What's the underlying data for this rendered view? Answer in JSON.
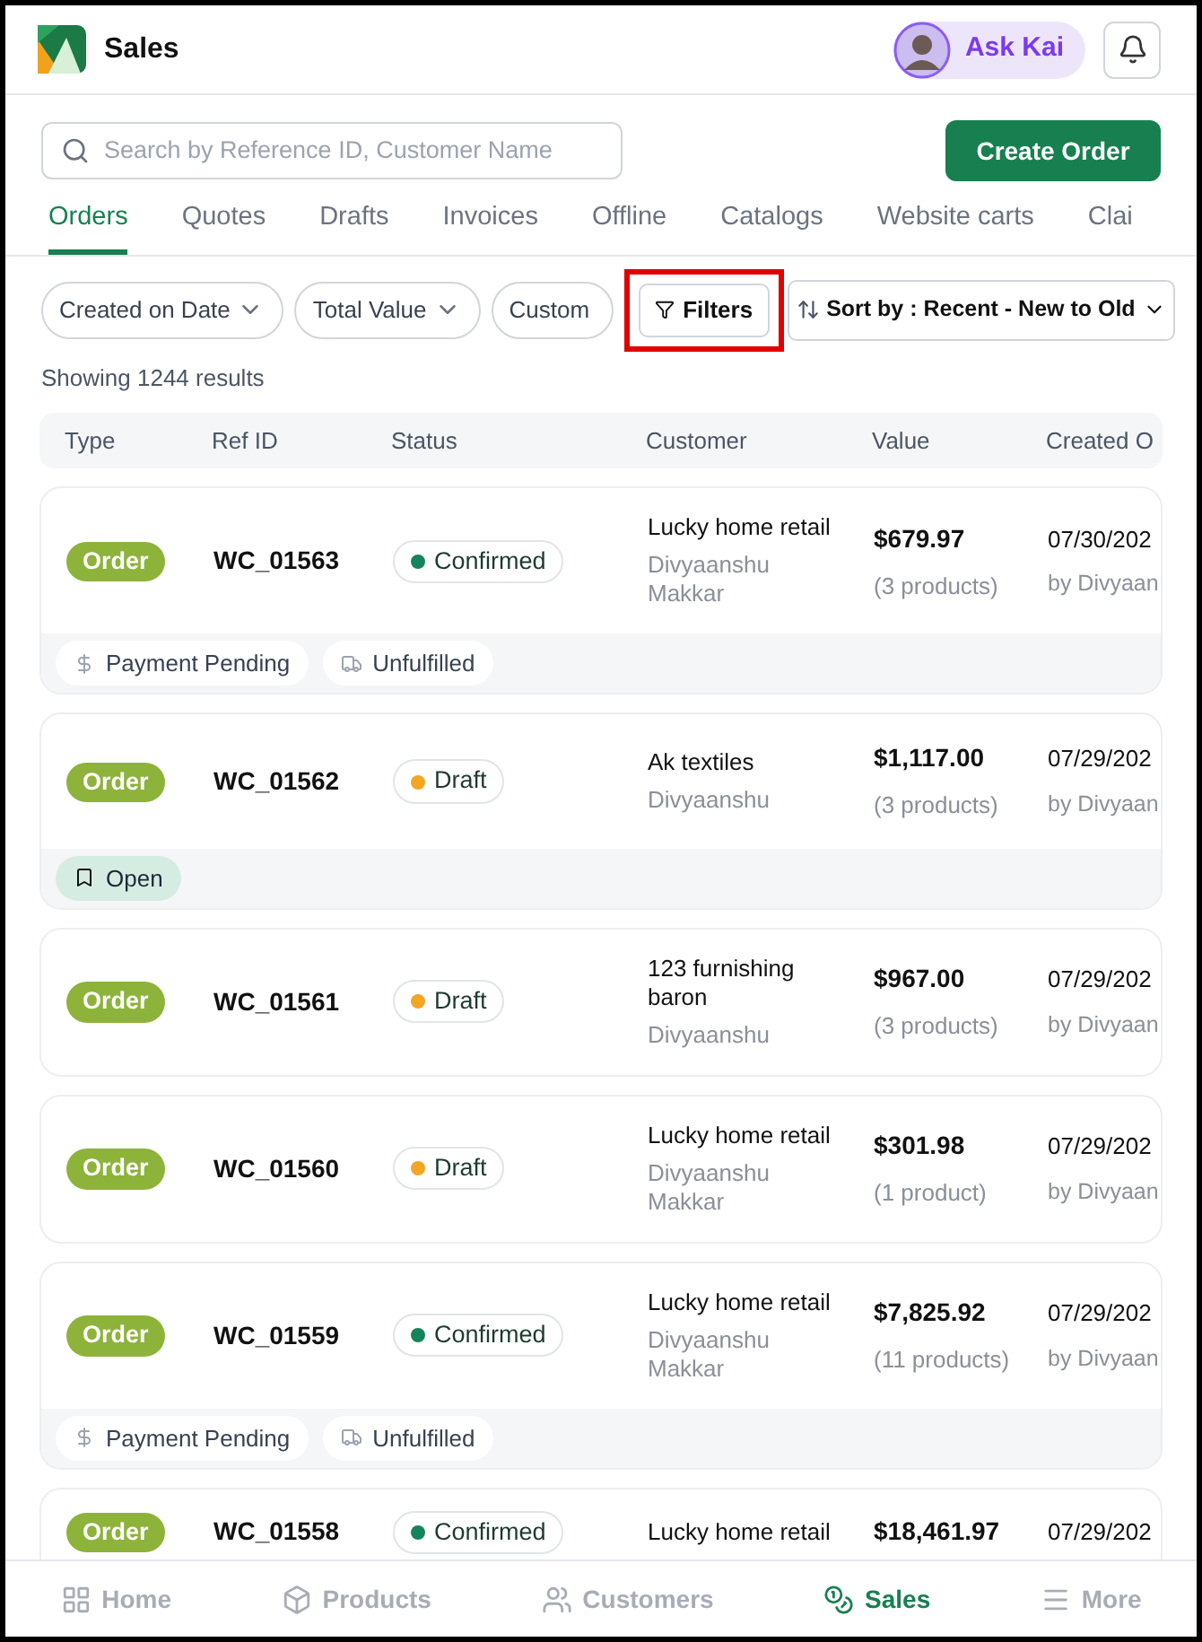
{
  "header": {
    "title": "Sales",
    "assistant": "Ask Kai"
  },
  "search": {
    "placeholder": "Search by Reference ID, Customer Name"
  },
  "create_button": "Create Order",
  "tabs": [
    {
      "label": "Orders",
      "selected": true
    },
    {
      "label": "Quotes",
      "selected": false
    },
    {
      "label": "Drafts",
      "selected": false
    },
    {
      "label": "Invoices",
      "selected": false
    },
    {
      "label": "Offline",
      "selected": false
    },
    {
      "label": "Catalogs",
      "selected": false
    },
    {
      "label": "Website carts",
      "selected": false
    },
    {
      "label": "Clai",
      "selected": false
    }
  ],
  "filters": {
    "chips": [
      "Created on Date",
      "Total Value",
      "Custom"
    ],
    "filters_button": {
      "label": "Filters",
      "highlighted": true
    },
    "sort": "Sort by : Recent - New to Old"
  },
  "result_count": "Showing 1244 results",
  "table": {
    "columns": [
      "Type",
      "Ref ID",
      "Status",
      "Customer",
      "Value",
      "Created O"
    ],
    "rows": [
      {
        "type": "Order",
        "ref_id": "WC_01563",
        "status": {
          "label": "Confirmed",
          "color": "#15845a"
        },
        "customer": "Lucky home retail",
        "contact": "Divyaanshu Makkar",
        "value": "$679.97",
        "products": "(3 products)",
        "date": "07/30/202",
        "by": "by Divyaan",
        "tags": [
          {
            "kind": "payment",
            "label": "Payment Pending"
          },
          {
            "kind": "fulfillment",
            "label": "Unfulfilled"
          }
        ]
      },
      {
        "type": "Order",
        "ref_id": "WC_01562",
        "status": {
          "label": "Draft",
          "color": "#f2a623"
        },
        "customer": "Ak textiles",
        "contact": "Divyaanshu",
        "value": "$1,117.00",
        "products": "(3 products)",
        "date": "07/29/202",
        "by": "by Divyaan",
        "tags": [
          {
            "kind": "open",
            "label": "Open"
          }
        ]
      },
      {
        "type": "Order",
        "ref_id": "WC_01561",
        "status": {
          "label": "Draft",
          "color": "#f2a623"
        },
        "customer": "123 furnishing baron",
        "contact": "Divyaanshu",
        "value": "$967.00",
        "products": "(3 products)",
        "date": "07/29/202",
        "by": "by Divyaan"
      },
      {
        "type": "Order",
        "ref_id": "WC_01560",
        "status": {
          "label": "Draft",
          "color": "#f2a623"
        },
        "customer": "Lucky home retail",
        "contact": "Divyaanshu Makkar",
        "value": "$301.98",
        "products": "(1 product)",
        "date": "07/29/202",
        "by": "by Divyaan"
      },
      {
        "type": "Order",
        "ref_id": "WC_01559",
        "status": {
          "label": "Confirmed",
          "color": "#15845a"
        },
        "customer": "Lucky home retail",
        "contact": "Divyaanshu Makkar",
        "value": "$7,825.92",
        "products": "(11 products)",
        "date": "07/29/202",
        "by": "by Divyaan",
        "tags": [
          {
            "kind": "payment",
            "label": "Payment Pending"
          },
          {
            "kind": "fulfillment",
            "label": "Unfulfilled"
          }
        ]
      },
      {
        "type": "Order",
        "ref_id": "WC_01558",
        "status": {
          "label": "Confirmed",
          "color": "#15845a"
        },
        "customer": "Lucky home retail",
        "value": "$18,461.97",
        "date": "07/29/202"
      }
    ]
  },
  "bottom_nav": [
    {
      "kind": "home",
      "label": "Home",
      "selected": false
    },
    {
      "kind": "products",
      "label": "Products",
      "selected": false
    },
    {
      "kind": "customers",
      "label": "Customers",
      "selected": false
    },
    {
      "kind": "sales",
      "label": "Sales",
      "selected": true
    },
    {
      "kind": "more",
      "label": "More",
      "selected": false
    }
  ]
}
